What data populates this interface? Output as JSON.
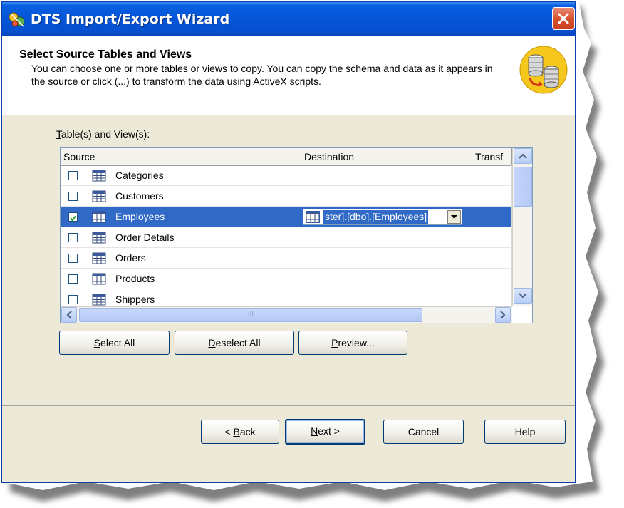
{
  "window": {
    "title": "DTS Import/Export Wizard",
    "close_label": "✕"
  },
  "header": {
    "title": "Select Source Tables and Views",
    "description": "You can choose one or more tables or views to copy.  You can copy the schema and data as it appears in the source or click (...) to transform the data using ActiveX scripts."
  },
  "list": {
    "label_prefix": "T",
    "label_rest": "able(s) and View(s):",
    "columns": [
      "Source",
      "Destination",
      "Transf"
    ],
    "rows": [
      {
        "name": "Categories",
        "checked": false,
        "selected": false,
        "destination": ""
      },
      {
        "name": "Customers",
        "checked": false,
        "selected": false,
        "destination": ""
      },
      {
        "name": "Employees",
        "checked": true,
        "selected": true,
        "destination": "ster].[dbo].[Employees]"
      },
      {
        "name": "Order Details",
        "checked": false,
        "selected": false,
        "destination": ""
      },
      {
        "name": "Orders",
        "checked": false,
        "selected": false,
        "destination": ""
      },
      {
        "name": "Products",
        "checked": false,
        "selected": false,
        "destination": ""
      },
      {
        "name": "Shippers",
        "checked": false,
        "selected": false,
        "destination": ""
      }
    ],
    "hscroll_grip": "III"
  },
  "actions": {
    "select_all_u": "S",
    "select_all_rest": "elect All",
    "deselect_all_u": "D",
    "deselect_all_rest": "eselect All",
    "preview_u": "P",
    "preview_rest": "review..."
  },
  "footer": {
    "back_pre": "< ",
    "back_u": "B",
    "back_rest": "ack",
    "next_u": "N",
    "next_rest": "ext >",
    "cancel": "Cancel",
    "help": "Help"
  },
  "colors": {
    "titlebar": "#0554d8",
    "selection": "#3169c6",
    "dialog_bg": "#ece9d8"
  }
}
